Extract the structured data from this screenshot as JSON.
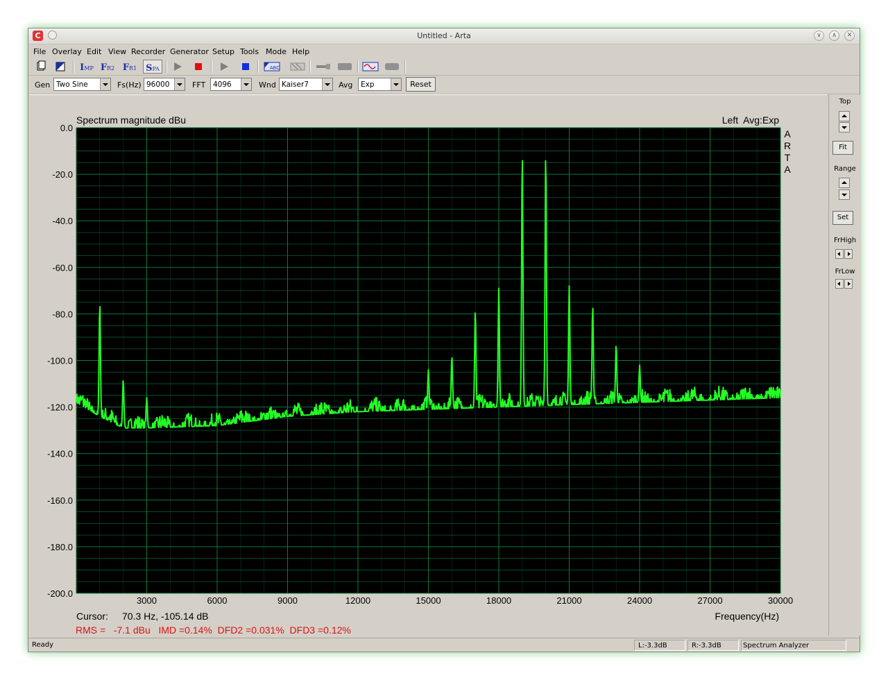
{
  "window": {
    "title": "Untitled - Arta",
    "app_icon": "arta-icon"
  },
  "menu": [
    "File",
    "Overlay",
    "Edit",
    "View",
    "Recorder",
    "Generator",
    "Setup",
    "Tools",
    "Mode",
    "Help"
  ],
  "toolbar": {
    "imp": "I",
    "imp_sub": "MP",
    "fr2": "F",
    "fr2_sub": "R2",
    "fr1": "F",
    "fr1_sub": "R1",
    "spa": "S",
    "spa_sub": "PA"
  },
  "controls": {
    "gen_label": "Gen",
    "gen_value": "Two Sine",
    "fs_label": "Fs(Hz)",
    "fs_value": "96000",
    "fft_label": "FFT",
    "fft_value": "4096",
    "wnd_label": "Wnd",
    "wnd_value": "Kaiser7",
    "avg_label": "Avg",
    "avg_value": "Exp",
    "reset_label": "Reset"
  },
  "side_panel": {
    "top_label": "Top",
    "fit_label": "Fit",
    "range_label": "Range",
    "set_label": "Set",
    "frhigh_label": "FrHigh",
    "frlow_label": "FrLow"
  },
  "chart": {
    "title": "Spectrum magnitude dBu",
    "channel_info": "Left  Avg:Exp",
    "watermark": "ARTA",
    "cursor_label": "Cursor:",
    "cursor_value": "70.3 Hz, -105.14 dB",
    "stats": "RMS =   -7.1 dBu   IMD =0.14%  DFD2 =0.031%  DFD3 =0.12%",
    "colors": {
      "background": "#000000",
      "grid": "#0d7a3a",
      "trace": "#22ff22",
      "stats": "#dd1111"
    }
  },
  "chart_data": {
    "type": "line",
    "title": "Spectrum magnitude dBu",
    "xlabel": "Frequency(Hz)",
    "ylabel": "",
    "xlim": [
      0,
      30000
    ],
    "ylim": [
      -200,
      0
    ],
    "grid": true,
    "x_ticks": [
      "3000",
      "6000",
      "9000",
      "12000",
      "15000",
      "18000",
      "21000",
      "24000",
      "27000",
      "30000"
    ],
    "y_ticks": [
      "0.0",
      "-20.0",
      "-40.0",
      "-60.0",
      "-80.0",
      "-100.0",
      "-120.0",
      "-140.0",
      "-160.0",
      "-180.0",
      "-200.0"
    ],
    "noise_floor": [
      [
        0,
        -118
      ],
      [
        1000,
        -124
      ],
      [
        2000,
        -129
      ],
      [
        3000,
        -129
      ],
      [
        6000,
        -128
      ],
      [
        9000,
        -124
      ],
      [
        12000,
        -122
      ],
      [
        15000,
        -121
      ],
      [
        18000,
        -120
      ],
      [
        21000,
        -119
      ],
      [
        24000,
        -118
      ],
      [
        27000,
        -117
      ],
      [
        30000,
        -116
      ]
    ],
    "peaks": [
      {
        "x": 1000,
        "y": -75
      },
      {
        "x": 2000,
        "y": -108
      },
      {
        "x": 3000,
        "y": -116
      },
      {
        "x": 15000,
        "y": -104
      },
      {
        "x": 16000,
        "y": -98
      },
      {
        "x": 17000,
        "y": -78
      },
      {
        "x": 18000,
        "y": -69
      },
      {
        "x": 19000,
        "y": -10
      },
      {
        "x": 20000,
        "y": -10
      },
      {
        "x": 21000,
        "y": -68
      },
      {
        "x": 22000,
        "y": -76
      },
      {
        "x": 23000,
        "y": -93
      },
      {
        "x": 24000,
        "y": -102
      }
    ],
    "series": [
      {
        "name": "",
        "values": []
      }
    ]
  },
  "status": {
    "ready": "Ready",
    "left_level": "L:-3.3dB",
    "right_level": "R:-3.3dB",
    "mode": "Spectrum Analyzer"
  }
}
